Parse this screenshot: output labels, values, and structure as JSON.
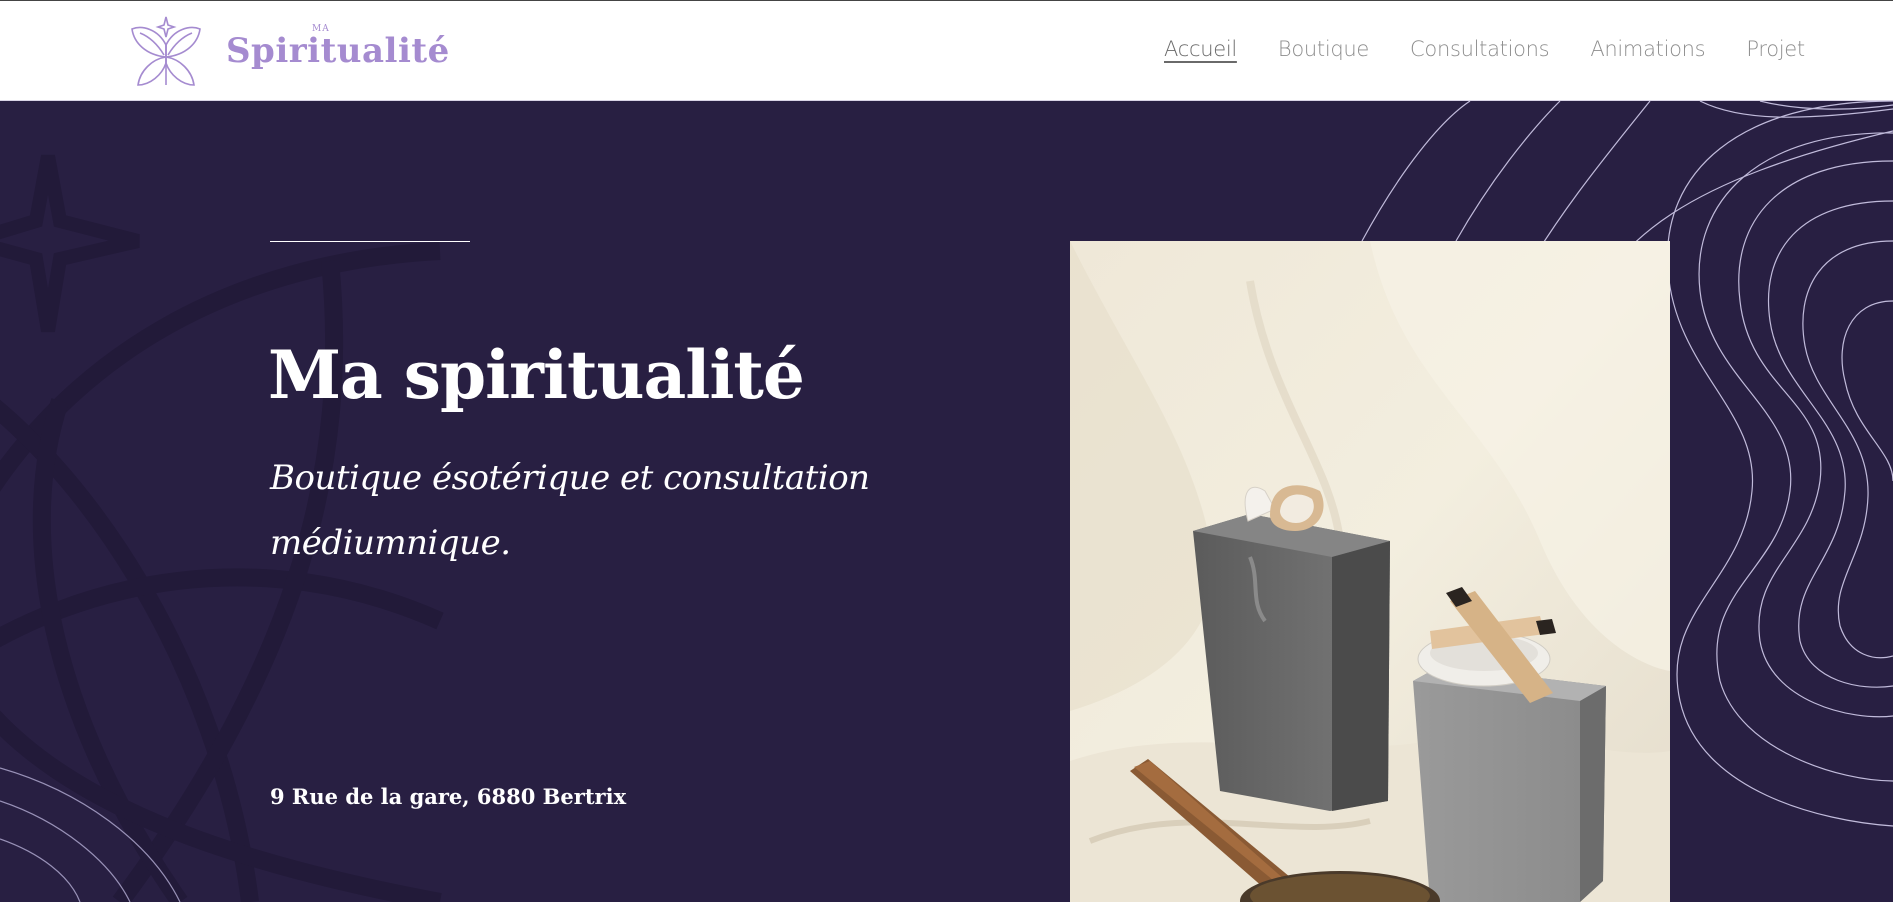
{
  "header": {
    "logo_icon": "butterfly-star-icon",
    "brand_prefix": "MA",
    "brand_name": "Spiritualité",
    "nav": [
      {
        "label": "Accueil",
        "active": true
      },
      {
        "label": "Boutique",
        "active": false
      },
      {
        "label": "Consultations",
        "active": false
      },
      {
        "label": "Animations",
        "active": false
      },
      {
        "label": "Projet",
        "active": false
      }
    ]
  },
  "hero": {
    "title": "Ma spiritualité",
    "tagline": "Boutique ésotérique et consultation médiumnique.",
    "address": "9 Rue de la gare, 6880 Bertrix",
    "photo_alt": "stones-crystals-palo-santo-photo"
  },
  "colors": {
    "accent": "#a58bd0",
    "hero_bg": "#281f42",
    "text_light": "#ffffff",
    "nav_text": "#8e8e8e"
  }
}
